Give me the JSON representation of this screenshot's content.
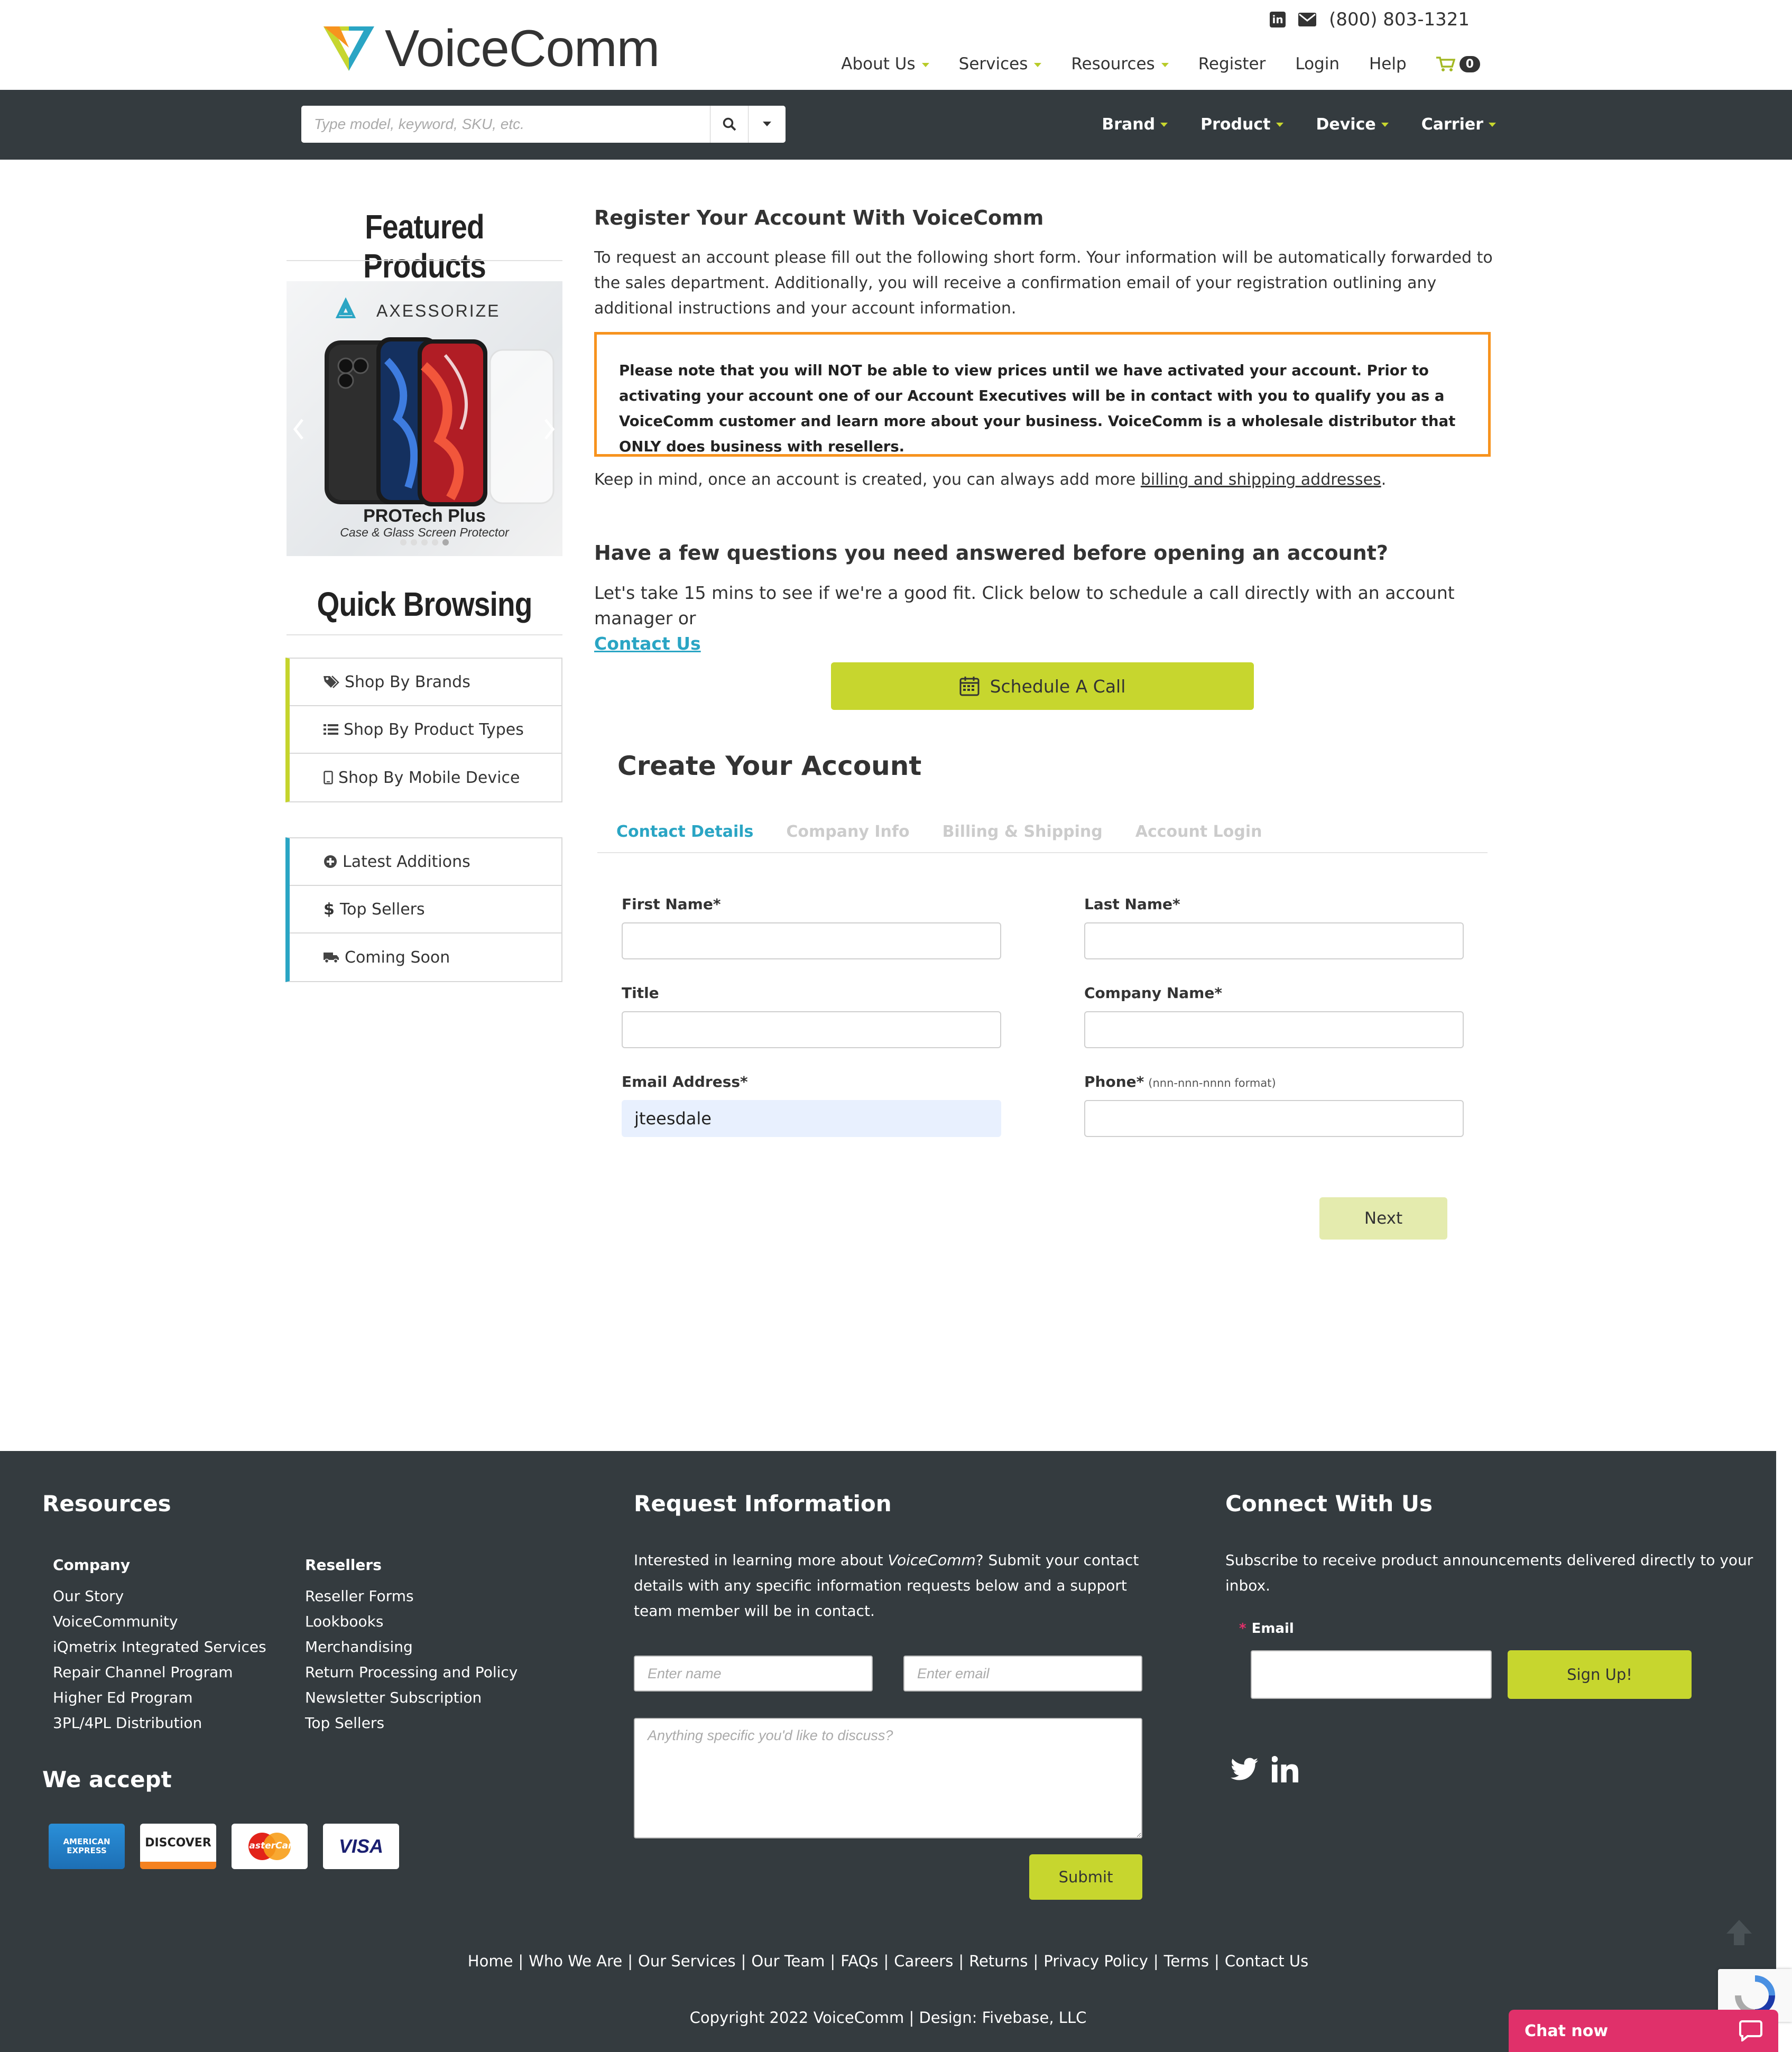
{
  "header": {
    "logo": {
      "voice": "Voice",
      "comm": "Comm"
    },
    "phone": "(800) 803-1321",
    "nav": [
      {
        "label": "About Us",
        "dropdown": true
      },
      {
        "label": "Services",
        "dropdown": true
      },
      {
        "label": "Resources",
        "dropdown": true
      },
      {
        "label": "Register",
        "dropdown": false
      },
      {
        "label": "Login",
        "dropdown": false
      },
      {
        "label": "Help",
        "dropdown": false
      }
    ],
    "cart_count": "0"
  },
  "searchbar": {
    "placeholder": "Type model, keyword, SKU, etc.",
    "categories": [
      "Brand",
      "Product",
      "Device",
      "Carrier"
    ]
  },
  "sidebar": {
    "featured_title": "Featured Products",
    "featured_banner": {
      "brand": "AXESSORIZE",
      "product": "PROTech Plus",
      "subtitle": "Case & Glass Screen Protector"
    },
    "quick_title": "Quick Browsing",
    "browse_links": [
      "Shop By Brands",
      "Shop By Product Types",
      "Shop By Mobile Device"
    ],
    "extra_links": [
      "Latest Additions",
      "Top Sellers",
      "Coming Soon"
    ]
  },
  "main": {
    "title": "Register Your Account With VoiceComm",
    "intro": "To request an account please fill out the following short form. Your information will be automatically forwarded to the sales department. Additionally, you will receive a confirmation email of your registration outlining any additional instructions and your account information.",
    "notice": "Please note that you will NOT be able to view prices until we have activated your account. Prior to activating your account one of our Account Executives will be in contact with you to qualify you as a VoiceComm customer and learn more about your business. VoiceComm is a wholesale distributor that ONLY does business with resellers.",
    "keep_in_mind_prefix": "Keep in mind, once an account is created, you can always add more ",
    "keep_in_mind_link": "billing and shipping addresses",
    "keep_in_mind_suffix": ".",
    "questions_title": "Have a few questions you need answered before opening an account?",
    "questions_text": "Let's take 15 mins to see if we're a good fit. Click below to schedule a call directly with an account manager or",
    "contact_link": "Contact Us",
    "schedule_button": "Schedule A Call",
    "create_title": "Create Your Account",
    "tabs": [
      {
        "label": "Contact Details",
        "active": true
      },
      {
        "label": "Company Info",
        "active": false
      },
      {
        "label": "Billing & Shipping",
        "active": false
      },
      {
        "label": "Account Login",
        "active": false
      }
    ],
    "form": {
      "first_name_label": "First Name",
      "last_name_label": "Last Name",
      "title_label": "Title",
      "company_label": "Company Name",
      "email_label": "Email Address",
      "email_value": "jteesdale",
      "phone_label": "Phone",
      "phone_hint": "(nnn-nnn-nnnn format)",
      "required_mark": "*",
      "next_button": "Next"
    }
  },
  "footer": {
    "resources_title": "Resources",
    "company_title": "Company",
    "company_links": [
      "Our Story",
      "VoiceCommunity",
      "iQmetrix Integrated Services",
      "Repair Channel Program",
      "Higher Ed Program",
      "3PL/4PL Distribution"
    ],
    "resellers_title": "Resellers",
    "resellers_links": [
      "Reseller Forms",
      "Lookbooks",
      "Merchandising",
      "Return Processing and Policy",
      "Newsletter Subscription",
      "Top Sellers"
    ],
    "accept_title": "We accept",
    "cards": [
      "AMERICAN EXPRESS",
      "DISCOVER",
      "MasterCard",
      "VISA"
    ],
    "request_title": "Request Information",
    "request_text_1": "Interested in learning more about ",
    "request_text_em": "VoiceComm",
    "request_text_2": "? Submit your contact details with any specific information requests below and a support team member will be in contact.",
    "name_placeholder": "Enter name",
    "email_placeholder": "Enter email",
    "message_placeholder": "Anything specific you'd like to discuss?",
    "submit_button": "Submit",
    "connect_title": "Connect With Us",
    "connect_text": "Subscribe to receive product announcements delivered directly to your inbox.",
    "email_label": "Email",
    "signup_button": "Sign Up!",
    "bottom_links": [
      "Home",
      "Who We Are",
      "Our Services",
      "Our Team",
      "FAQs",
      "Careers",
      "Returns",
      "Privacy Policy",
      "Terms",
      "Contact Us"
    ],
    "copyright_prefix": "Copyright 2022 ",
    "copyright_brand": "VoiceComm",
    "copyright_suffix": " | Design: Fivebase, LLC"
  },
  "chat": {
    "label": "Chat now"
  },
  "colors": {
    "accent_green": "#c7d62e",
    "accent_blue": "#2aa5c4",
    "notice_orange": "#f7931e",
    "dark_bar": "#343b3f",
    "chat_pink": "#e0306a"
  }
}
